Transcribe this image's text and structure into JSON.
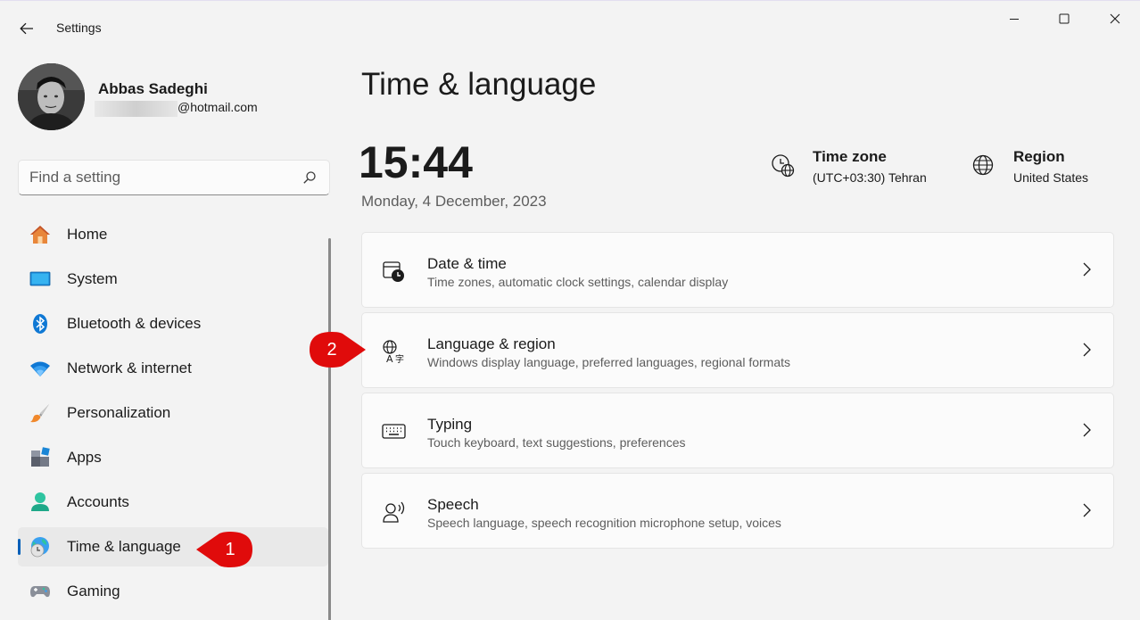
{
  "window": {
    "title": "Settings"
  },
  "profile": {
    "name": "Abbas Sadeghi",
    "email_suffix": "@hotmail.com"
  },
  "search": {
    "placeholder": "Find a setting"
  },
  "sidebar": {
    "items": [
      {
        "label": "Home",
        "icon": "home-icon"
      },
      {
        "label": "System",
        "icon": "system-icon"
      },
      {
        "label": "Bluetooth & devices",
        "icon": "bluetooth-icon"
      },
      {
        "label": "Network & internet",
        "icon": "wifi-icon"
      },
      {
        "label": "Personalization",
        "icon": "brush-icon"
      },
      {
        "label": "Apps",
        "icon": "apps-icon"
      },
      {
        "label": "Accounts",
        "icon": "accounts-icon"
      },
      {
        "label": "Time & language",
        "icon": "time-language-icon",
        "active": true
      },
      {
        "label": "Gaming",
        "icon": "gaming-icon"
      }
    ]
  },
  "main": {
    "title": "Time & language",
    "time": "15:44",
    "date": "Monday, 4 December, 2023",
    "timezone": {
      "label": "Time zone",
      "value": "(UTC+03:30) Tehran"
    },
    "region": {
      "label": "Region",
      "value": "United States"
    },
    "cards": [
      {
        "title": "Date & time",
        "subtitle": "Time zones, automatic clock settings, calendar display",
        "icon": "calendar-clock-icon"
      },
      {
        "title": "Language & region",
        "subtitle": "Windows display language, preferred languages, regional formats",
        "icon": "language-icon"
      },
      {
        "title": "Typing",
        "subtitle": "Touch keyboard, text suggestions, preferences",
        "icon": "keyboard-icon"
      },
      {
        "title": "Speech",
        "subtitle": "Speech language, speech recognition microphone setup, voices",
        "icon": "speech-icon"
      }
    ]
  },
  "annotations": {
    "callout_1": "1",
    "callout_2": "2",
    "color": "#e00b0b"
  },
  "colors": {
    "accent": "#005fb8",
    "background": "#f3f3f3",
    "card": "#fbfbfb"
  }
}
